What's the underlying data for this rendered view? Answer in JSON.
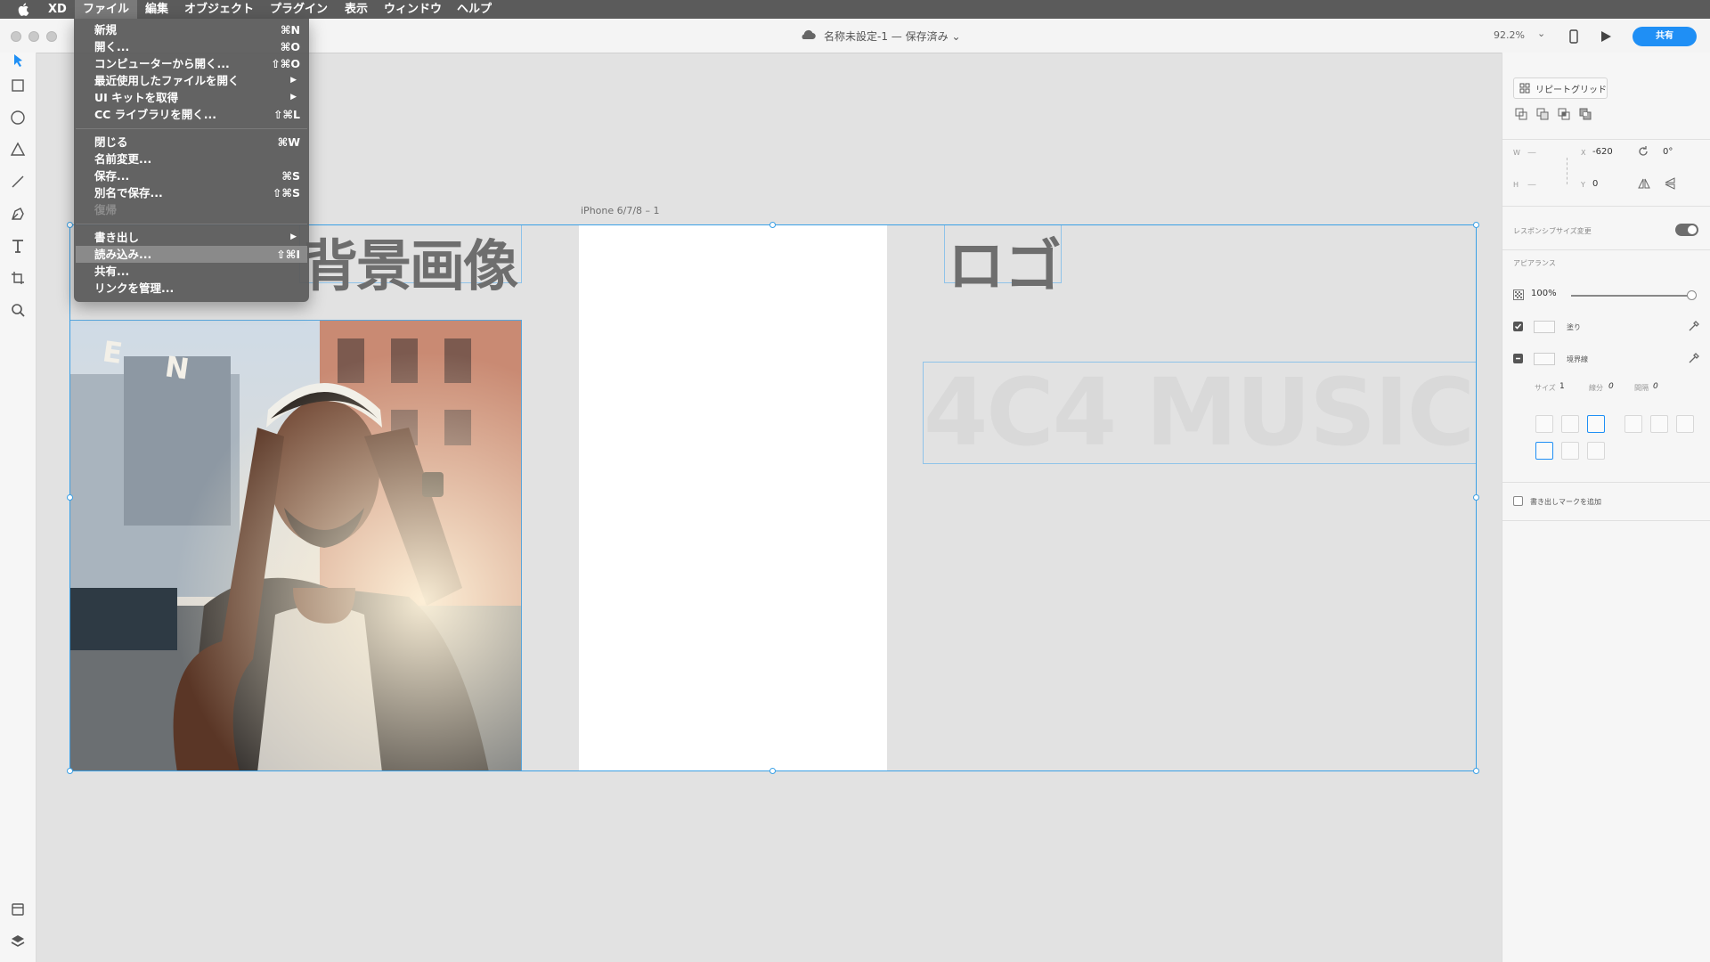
{
  "menubar": {
    "app": "XD",
    "items": [
      "ファイル",
      "編集",
      "オブジェクト",
      "プラグイン",
      "表示",
      "ウィンドウ",
      "ヘルプ"
    ]
  },
  "titlebar": {
    "doc_name": "名称未設定-1",
    "sep": "—",
    "status": "保存済み",
    "zoom": "92.2%",
    "share_label": "共有"
  },
  "canvas": {
    "artboard_label": "iPhone 6/7/8 – 1",
    "bg_image_text": "背景画像",
    "logo_text": "ロゴ",
    "music_text": "4C4 MUSIC"
  },
  "file_menu": {
    "items": [
      {
        "label": "新規",
        "shortcut": "⌘N"
      },
      {
        "label": "開く...",
        "shortcut": "⌘O"
      },
      {
        "label": "コンピューターから開く...",
        "shortcut": "⇧⌘O"
      },
      {
        "label": "最近使用したファイルを開く",
        "submenu": true
      },
      {
        "label": "UI キットを取得",
        "submenu": true
      },
      {
        "label": "CC ライブラリを開く...",
        "shortcut": "⇧⌘L"
      },
      {
        "label": "閉じる",
        "shortcut": "⌘W"
      },
      {
        "label": "名前変更..."
      },
      {
        "label": "保存...",
        "shortcut": "⌘S"
      },
      {
        "label": "別名で保存...",
        "shortcut": "⇧⌘S"
      },
      {
        "label": "復帰",
        "disabled": true
      },
      {
        "label": "書き出し",
        "submenu": true
      },
      {
        "label": "読み込み...",
        "shortcut": "⇧⌘I",
        "highlighted": true
      },
      {
        "label": "共有..."
      },
      {
        "label": "リンクを管理..."
      }
    ]
  },
  "panel": {
    "repeat_grid": "リピートグリッド",
    "w_label": "W",
    "h_label": "H",
    "w_value": "—",
    "h_value": "—",
    "x_label": "X",
    "y_label": "Y",
    "x_value": "-620",
    "y_value": "0",
    "rotation": "0°",
    "responsive": "レスポンシブサイズ変更",
    "appearance": "アピアランス",
    "opacity": "100%",
    "opacity_level": 1.0,
    "fill": "塗り",
    "border": "境界線",
    "size_label": "サイズ",
    "size_value": "1",
    "dash_label": "線分",
    "dash_value": "0",
    "gap_label": "間隔",
    "gap_value": "0",
    "export_mark": "書き出しマークを追加"
  },
  "colors": {
    "accent": "#1f8ff5",
    "selection": "#3aa0e6",
    "menubar": "#5b5b5b"
  }
}
